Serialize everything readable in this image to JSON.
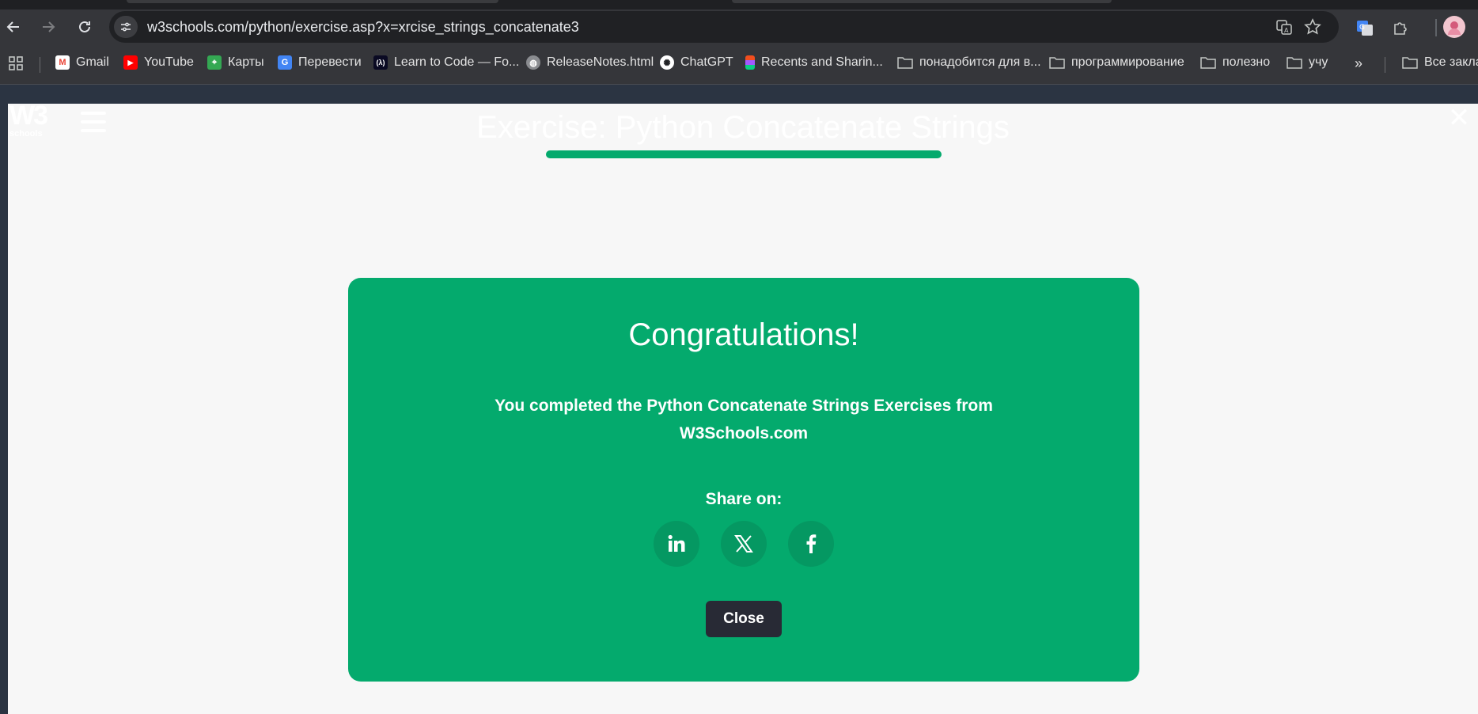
{
  "browser": {
    "url": "w3schools.com/python/exercise.asp?x=xrcise_strings_concatenate3",
    "bookmarks": [
      {
        "label": "Gmail",
        "icon": "gmail-icon"
      },
      {
        "label": "YouTube",
        "icon": "youtube-icon"
      },
      {
        "label": "Карты",
        "icon": "maps-icon"
      },
      {
        "label": "Перевести",
        "icon": "translate-icon"
      },
      {
        "label": "Learn to Code — Fo...",
        "icon": "freecodecamp-icon"
      },
      {
        "label": "ReleaseNotes.html",
        "icon": "globe-icon"
      },
      {
        "label": "ChatGPT",
        "icon": "chatgpt-icon"
      },
      {
        "label": "Recents and Sharin...",
        "icon": "figma-icon"
      },
      {
        "label": "понадобится для в...",
        "icon": "folder-icon"
      },
      {
        "label": "программирование",
        "icon": "folder-icon"
      },
      {
        "label": "полезно",
        "icon": "folder-icon"
      },
      {
        "label": "учу",
        "icon": "folder-icon"
      },
      {
        "label": "Все закла",
        "icon": "folder-icon"
      }
    ]
  },
  "page": {
    "logo_text": "W3",
    "logo_sub": "schools",
    "exercise_title": "Exercise: Python Concatenate Strings",
    "progress": 1.0,
    "modal": {
      "title": "Congratulations!",
      "message": "You completed the Python Concatenate Strings Exercises from W3Schools.com",
      "share_label": "Share on:",
      "share_buttons": [
        "linkedin-icon",
        "x-icon",
        "facebook-icon"
      ],
      "close_label": "Close"
    }
  },
  "colors": {
    "accent_green": "#04aa6d",
    "dark_button": "#282a35"
  }
}
